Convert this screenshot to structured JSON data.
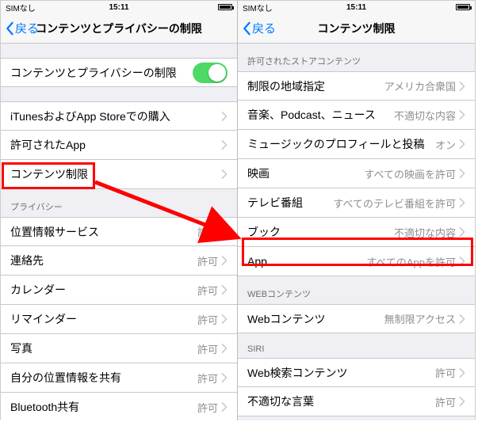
{
  "left": {
    "status": {
      "carrier": "SIMなし",
      "wifi": "▾",
      "time": "15:11",
      "right": "◎ ■"
    },
    "nav": {
      "back": "戻る",
      "title": "コンテンツとプライバシーの制限"
    },
    "group1": [
      {
        "label": "コンテンツとプライバシーの制限",
        "toggle": true
      }
    ],
    "group2": [
      {
        "label": "iTunesおよびApp Storeでの購入"
      },
      {
        "label": "許可されたApp"
      },
      {
        "label": "コンテンツ制限",
        "highlight": true
      }
    ],
    "section_privacy": "プライバシー",
    "group3": [
      {
        "label": "位置情報サービス",
        "value": "許可"
      },
      {
        "label": "連絡先",
        "value": "許可"
      },
      {
        "label": "カレンダー",
        "value": "許可"
      },
      {
        "label": "リマインダー",
        "value": "許可"
      },
      {
        "label": "写真",
        "value": "許可"
      },
      {
        "label": "自分の位置情報を共有",
        "value": "許可"
      },
      {
        "label": "Bluetooth共有",
        "value": "許可"
      }
    ]
  },
  "right": {
    "status": {
      "carrier": "SIMなし",
      "wifi": "▾",
      "time": "15:11",
      "right": "◎ ■"
    },
    "nav": {
      "back": "戻る",
      "title": "コンテンツ制限"
    },
    "section_store": "許可されたストアコンテンツ",
    "group1": [
      {
        "label": "制限の地域指定",
        "value": "アメリカ合衆国"
      },
      {
        "label": "音楽、Podcast、ニュース",
        "value": "不適切な内容"
      },
      {
        "label": "ミュージックのプロフィールと投稿",
        "value": "オン"
      },
      {
        "label": "映画",
        "value": "すべての映画を許可"
      },
      {
        "label": "テレビ番組",
        "value": "すべてのテレビ番組を許可"
      },
      {
        "label": "ブック",
        "value": "不適切な内容"
      },
      {
        "label": "App",
        "value": "すべてのAppを許可",
        "highlight": true
      }
    ],
    "section_web": "WEBコンテンツ",
    "group2": [
      {
        "label": "Webコンテンツ",
        "value": "無制限アクセス"
      }
    ],
    "section_siri": "SIRI",
    "group3": [
      {
        "label": "Web検索コンテンツ",
        "value": "許可"
      },
      {
        "label": "不適切な言葉",
        "value": "許可"
      }
    ]
  }
}
